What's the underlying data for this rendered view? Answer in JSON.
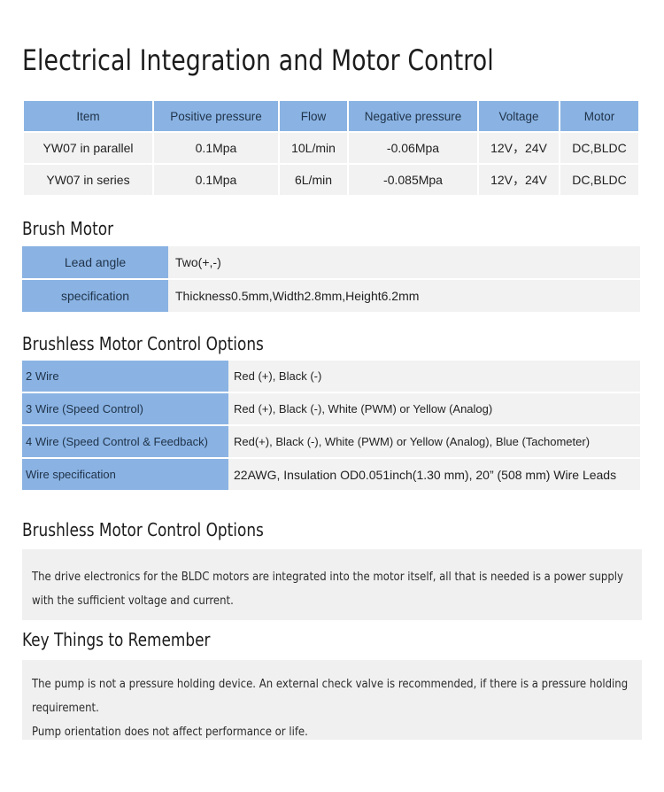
{
  "document": {
    "title": "Electrical Integration and Motor Control"
  },
  "spec_table": {
    "headers": [
      "Item",
      "Positive pressure",
      "Flow",
      "Negative pressure",
      "Voltage",
      "Motor"
    ],
    "rows": [
      {
        "item": "YW07 in parallel",
        "positive_pressure": "0.1Mpa",
        "flow": "10L/min",
        "negative_pressure": "-0.06Mpa",
        "voltage": "12V，24V",
        "motor": "DC,BLDC"
      },
      {
        "item": "YW07 in series",
        "positive_pressure": "0.1Mpa",
        "flow": "6L/min",
        "negative_pressure": "-0.085Mpa",
        "voltage": "12V，24V",
        "motor": "DC,BLDC"
      }
    ]
  },
  "brush_motor": {
    "heading": "Brush Motor",
    "rows": [
      {
        "label": "Lead angle",
        "value": "Two(+,-)"
      },
      {
        "label": "specification",
        "value": "Thickness0.5mm,Width2.8mm,Height6.2mm"
      }
    ]
  },
  "brushless_options": {
    "heading": "Brushless Motor Control Options",
    "rows": [
      {
        "label": "2 Wire",
        "value": "Red (+), Black (-)"
      },
      {
        "label": "3 Wire (Speed Control)",
        "value": "Red (+), Black (-), White (PWM) or Yellow (Analog)"
      },
      {
        "label": "4 Wire (Speed Control & Feedback)",
        "value": "Red(+), Black (-), White (PWM) or Yellow (Analog), Blue (Tachometer)"
      },
      {
        "label": "Wire specification",
        "value": "22AWG, Insulation OD0.051inch(1.30 mm), 20” (508 mm) Wire Leads"
      }
    ]
  },
  "brushless_intro": {
    "heading": "Brushless Motor Control Options",
    "paragraph": "The drive electronics for the BLDC motors are integrated into the motor itself, all that is needed is a power supply with the sufficient voltage and current."
  },
  "key_things": {
    "heading": "Key Things to Remember",
    "paragraphs": [
      "The pump is not a pressure holding device. An external check valve is recommended, if there is a pressure holding requirement.",
      "Pump orientation does not affect performance or life."
    ]
  },
  "colors": {
    "header_blue": "#8ab3e3",
    "cell_gray": "#f2f2f2",
    "panel_gray": "#f0f0f0",
    "header_text": "#20334a"
  }
}
